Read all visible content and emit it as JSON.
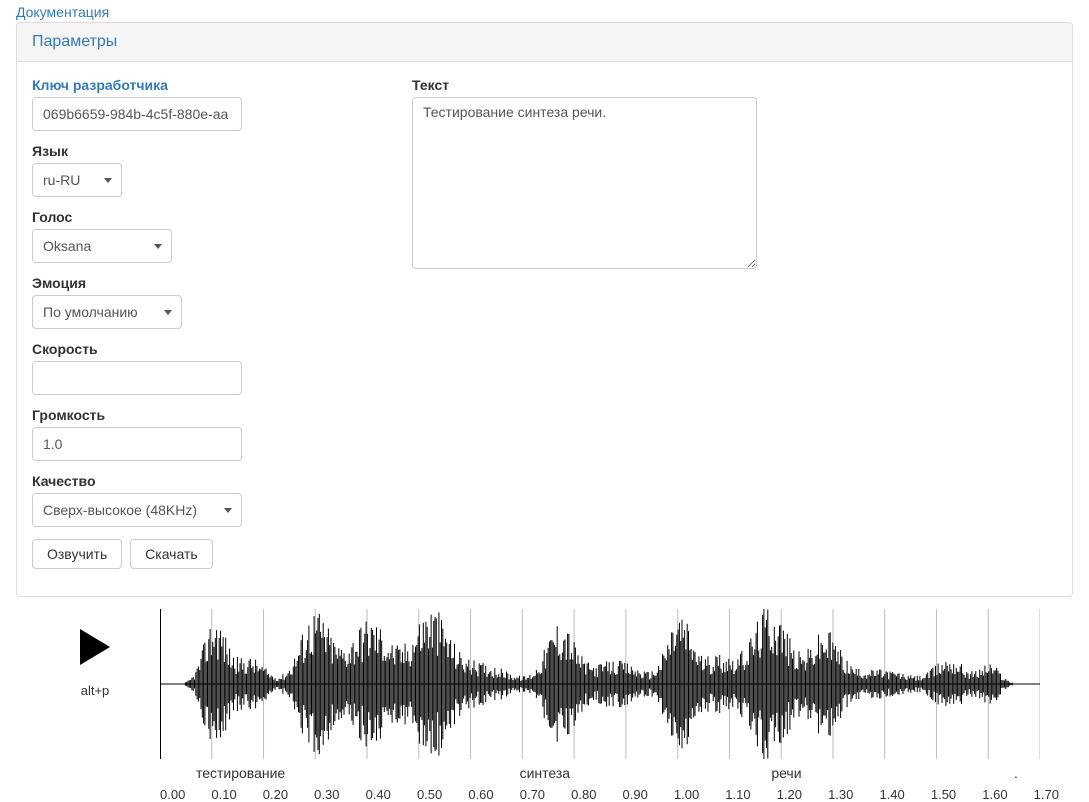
{
  "header": {
    "doc_link": "Документация",
    "panel_title": "Параметры"
  },
  "form": {
    "dev_key_label": "Ключ разработчика",
    "dev_key_value": "069b6659-984b-4c5f-880e-aa",
    "language_label": "Язык",
    "language_value": "ru-RU",
    "voice_label": "Голос",
    "voice_value": "Oksana",
    "emotion_label": "Эмоция",
    "emotion_value": "По умолчанию",
    "speed_label": "Скорость",
    "speed_value": "",
    "volume_label": "Громкость",
    "volume_value": "1.0",
    "quality_label": "Качество",
    "quality_value": "Сверх-высокое (48KHz)",
    "text_label": "Текст",
    "text_value": "Тестирование синтеза речи.",
    "btn_speak": "Озвучить",
    "btn_download": "Скачать"
  },
  "player": {
    "hotkey": "alt+p",
    "ticks": [
      "0.00",
      "0.10",
      "0.20",
      "0.30",
      "0.40",
      "0.50",
      "0.60",
      "0.70",
      "0.80",
      "0.90",
      "1.00",
      "1.10",
      "1.20",
      "1.30",
      "1.40",
      "1.50",
      "1.60",
      "1.70"
    ],
    "words": [
      {
        "label": "тестирование",
        "left_pct": 4
      },
      {
        "label": "синтеза",
        "left_pct": 40
      },
      {
        "label": "речи",
        "left_pct": 68
      },
      {
        "label": ".",
        "left_pct": 95
      }
    ]
  }
}
